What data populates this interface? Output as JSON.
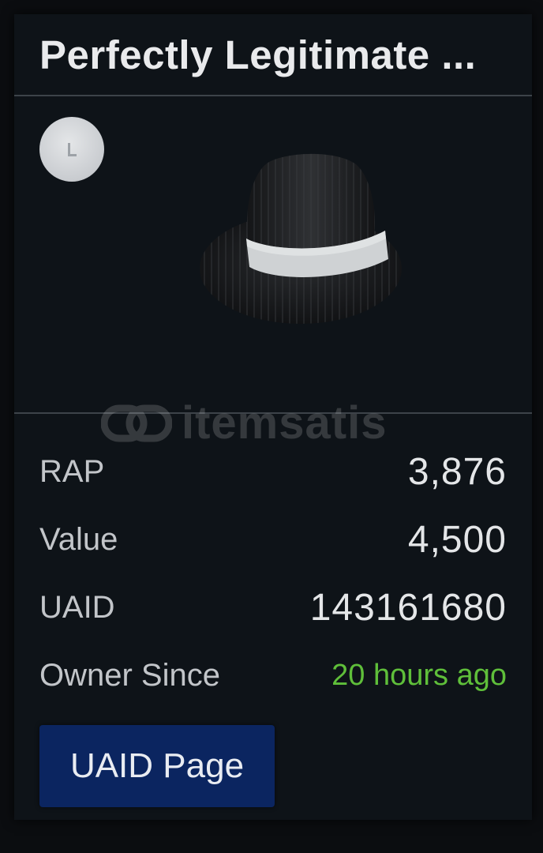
{
  "item": {
    "title": "Perfectly Legitimate ...",
    "image_icon": "fedora-hat-icon",
    "badge_icon": "limited-badge-icon"
  },
  "stats": [
    {
      "label": "RAP",
      "value": "3,876"
    },
    {
      "label": "Value",
      "value": "4,500"
    },
    {
      "label": "UAID",
      "value": "143161680"
    },
    {
      "label": "Owner Since",
      "value": "20 hours ago"
    }
  ],
  "actions": {
    "uaid_page_label": "UAID Page"
  },
  "watermark": {
    "text": "itemsatis"
  },
  "colors": {
    "background": "#0e1318",
    "divider": "#3d4349",
    "owner_since": "#5fbf3a",
    "button": "#0b2560"
  }
}
